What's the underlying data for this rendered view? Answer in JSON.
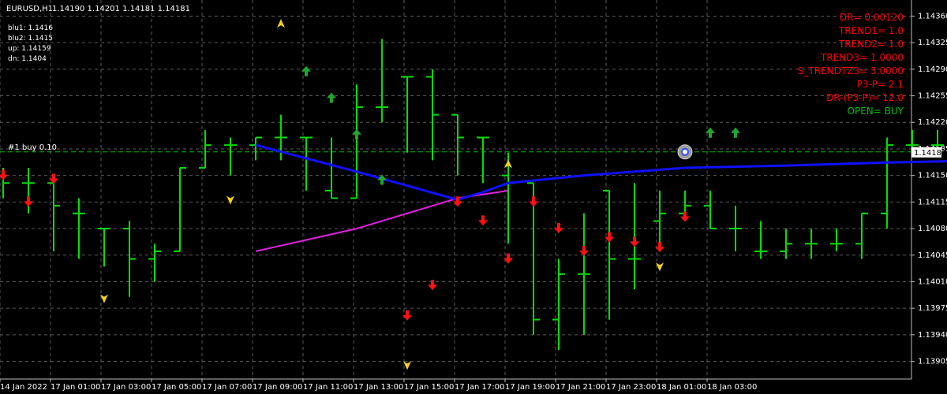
{
  "header": {
    "symbol_timeframe": "EURUSD,H1",
    "ohlc": "1.14190 1.14201 1.14181 1.14181"
  },
  "info_left": [
    {
      "label": "blu1: 1.1416"
    },
    {
      "label": "blu2: 1.1415"
    },
    {
      "label": "up: 1.14159"
    },
    {
      "label": "dn: 1.1404"
    }
  ],
  "info_right": [
    {
      "text": "DR= 0.00120",
      "color": "#ff0000"
    },
    {
      "text": "TREND1= 1.0",
      "color": "#ff0000"
    },
    {
      "text": "TREND2= 1.0",
      "color": "#ff0000"
    },
    {
      "text": "TREND3= 1.0000",
      "color": "#ff0000"
    },
    {
      "text": "S_TRENDTZ3= 3.0000",
      "color": "#ff0000"
    },
    {
      "text": "P3-P= 2.1",
      "color": "#ff0000"
    },
    {
      "text": "DR-(P3-P)= 12.0",
      "color": "#ff0000"
    },
    {
      "text": "OPEN= BUY",
      "color": "#00c000"
    }
  ],
  "order_line": {
    "label": "#1 buy 0.10",
    "price": 1.14181
  },
  "current_price_label": "1.14181",
  "colors": {
    "background": "#000000",
    "grid": "#5a5a5a",
    "bars": "#00e000",
    "blue_line": "#1010ff",
    "magenta_line": "#e020e0",
    "buy_arrow": "#21a531",
    "sell_arrow": "#ff1010",
    "fractal": "#f2d21c",
    "text": "#ffffff"
  },
  "chart_data": {
    "type": "ohlc",
    "price_axis": {
      "min": 1.1389,
      "max": 1.14375,
      "ticks": [
        1.1436,
        1.14325,
        1.1429,
        1.14255,
        1.1422,
        1.14185,
        1.1415,
        1.14115,
        1.1408,
        1.14045,
        1.1401,
        1.13975,
        1.1394,
        1.13905
      ]
    },
    "time_labels": [
      "14 Jan 2022",
      "17 Jan 01:00",
      "17 Jan 03:00",
      "17 Jan 05:00",
      "17 Jan 07:00",
      "17 Jan 09:00",
      "17 Jan 11:00",
      "17 Jan 13:00",
      "17 Jan 15:00",
      "17 Jan 17:00",
      "17 Jan 19:00",
      "17 Jan 21:00",
      "17 Jan 23:00",
      "18 Jan 01:00",
      "18 Jan 03:00"
    ],
    "bars": [
      {
        "o": 1.1415,
        "h": 1.1416,
        "l": 1.1412,
        "c": 1.1414
      },
      {
        "o": 1.1414,
        "h": 1.1416,
        "l": 1.141,
        "c": 1.1414
      },
      {
        "o": 1.1414,
        "h": 1.1414,
        "l": 1.1405,
        "c": 1.1411
      },
      {
        "o": 1.141,
        "h": 1.1412,
        "l": 1.1404,
        "c": 1.141
      },
      {
        "o": 1.1408,
        "h": 1.1408,
        "l": 1.1403,
        "c": 1.1408
      },
      {
        "o": 1.1408,
        "h": 1.1409,
        "l": 1.1399,
        "c": 1.1404
      },
      {
        "o": 1.1404,
        "h": 1.1406,
        "l": 1.1401,
        "c": 1.1405
      },
      {
        "o": 1.1405,
        "h": 1.1416,
        "l": 1.1405,
        "c": 1.1416
      },
      {
        "o": 1.1416,
        "h": 1.1421,
        "l": 1.1416,
        "c": 1.1419
      },
      {
        "o": 1.1419,
        "h": 1.142,
        "l": 1.1415,
        "c": 1.1419
      },
      {
        "o": 1.1419,
        "h": 1.142,
        "l": 1.1417,
        "c": 1.142
      },
      {
        "o": 1.142,
        "h": 1.1423,
        "l": 1.1417,
        "c": 1.142
      },
      {
        "o": 1.142,
        "h": 1.142,
        "l": 1.1413,
        "c": 1.142
      },
      {
        "o": 1.1413,
        "h": 1.142,
        "l": 1.1412,
        "c": 1.1412
      },
      {
        "o": 1.1412,
        "h": 1.1427,
        "l": 1.1412,
        "c": 1.1424
      },
      {
        "o": 1.1424,
        "h": 1.1433,
        "l": 1.1422,
        "c": 1.1424
      },
      {
        "o": 1.1428,
        "h": 1.1428,
        "l": 1.1418,
        "c": 1.1428
      },
      {
        "o": 1.1428,
        "h": 1.1429,
        "l": 1.1417,
        "c": 1.1423
      },
      {
        "o": 1.1423,
        "h": 1.1423,
        "l": 1.1415,
        "c": 1.142
      },
      {
        "o": 1.142,
        "h": 1.142,
        "l": 1.1414,
        "c": 1.142
      },
      {
        "o": 1.1415,
        "h": 1.1418,
        "l": 1.1406,
        "c": 1.1414
      },
      {
        "o": 1.1414,
        "h": 1.1414,
        "l": 1.1394,
        "c": 1.1396
      },
      {
        "o": 1.1396,
        "h": 1.1404,
        "l": 1.1392,
        "c": 1.1402
      },
      {
        "o": 1.1402,
        "h": 1.141,
        "l": 1.1394,
        "c": 1.1402
      },
      {
        "o": 1.1413,
        "h": 1.1413,
        "l": 1.1396,
        "c": 1.1404
      },
      {
        "o": 1.1404,
        "h": 1.1414,
        "l": 1.14,
        "c": 1.1404
      },
      {
        "o": 1.1409,
        "h": 1.1413,
        "l": 1.1406,
        "c": 1.141
      },
      {
        "o": 1.141,
        "h": 1.1413,
        "l": 1.1409,
        "c": 1.1411
      },
      {
        "o": 1.1411,
        "h": 1.1413,
        "l": 1.1408,
        "c": 1.1408
      },
      {
        "o": 1.1408,
        "h": 1.1411,
        "l": 1.1405,
        "c": 1.1408
      },
      {
        "o": 1.1405,
        "h": 1.1409,
        "l": 1.1404,
        "c": 1.1405
      },
      {
        "o": 1.1405,
        "h": 1.1408,
        "l": 1.1404,
        "c": 1.1406
      },
      {
        "o": 1.1406,
        "h": 1.1408,
        "l": 1.1404,
        "c": 1.1406
      },
      {
        "o": 1.1406,
        "h": 1.1408,
        "l": 1.1405,
        "c": 1.1406
      },
      {
        "o": 1.1406,
        "h": 1.141,
        "l": 1.1404,
        "c": 1.141
      },
      {
        "o": 1.141,
        "h": 1.142,
        "l": 1.1408,
        "c": 1.1419
      },
      {
        "o": 1.1419,
        "h": 1.1421,
        "l": 1.1418,
        "c": 1.1419
      },
      {
        "o": 1.1419,
        "h": 1.1421,
        "l": 1.1418,
        "c": 1.1419
      },
      {
        "o": 1.1419,
        "h": 1.1421,
        "l": 1.1418,
        "c": 1.1418
      },
      {
        "o": 1.1418,
        "h": 1.142,
        "l": 1.1418,
        "c": 1.1418
      }
    ],
    "blue_line": [
      {
        "bar": 10,
        "price": 1.1419
      },
      {
        "bar": 14,
        "price": 1.14155
      },
      {
        "bar": 18,
        "price": 1.14118
      },
      {
        "bar": 19,
        "price": 1.14128
      },
      {
        "bar": 20,
        "price": 1.1414
      },
      {
        "bar": 23,
        "price": 1.1415
      },
      {
        "bar": 27,
        "price": 1.1416
      },
      {
        "bar": 31,
        "price": 1.14163
      },
      {
        "bar": 35,
        "price": 1.14167
      },
      {
        "bar": 39,
        "price": 1.1417
      }
    ],
    "magenta_line": [
      {
        "bar": 10,
        "price": 1.1405
      },
      {
        "bar": 14,
        "price": 1.1408
      },
      {
        "bar": 18,
        "price": 1.1412
      },
      {
        "bar": 20,
        "price": 1.1413
      }
    ],
    "buy_arrows": [
      {
        "bar": 12,
        "price": 1.14288
      },
      {
        "bar": 13,
        "price": 1.14253
      },
      {
        "bar": 14,
        "price": 1.14205
      },
      {
        "bar": 15,
        "price": 1.14145
      },
      {
        "bar": 28,
        "price": 1.14207
      },
      {
        "bar": 29,
        "price": 1.14207
      }
    ],
    "sell_arrows": [
      {
        "bar": 0,
        "price": 1.1415
      },
      {
        "bar": 1,
        "price": 1.14115
      },
      {
        "bar": 2,
        "price": 1.14145
      },
      {
        "bar": 17,
        "price": 1.14005
      },
      {
        "bar": 16,
        "price": 1.13965
      },
      {
        "bar": 18,
        "price": 1.14115
      },
      {
        "bar": 19,
        "price": 1.1409
      },
      {
        "bar": 20,
        "price": 1.1404
      },
      {
        "bar": 21,
        "price": 1.14115
      },
      {
        "bar": 22,
        "price": 1.1408
      },
      {
        "bar": 23,
        "price": 1.1405
      },
      {
        "bar": 24,
        "price": 1.14068
      },
      {
        "bar": 25,
        "price": 1.14062
      },
      {
        "bar": 26,
        "price": 1.14055
      },
      {
        "bar": 27,
        "price": 1.14095
      }
    ],
    "fractals_up": [
      {
        "bar": 11,
        "price": 1.1435
      },
      {
        "bar": 20,
        "price": 1.14165
      }
    ],
    "fractals_down": [
      {
        "bar": 9,
        "price": 1.14118
      },
      {
        "bar": 4,
        "price": 1.13988
      },
      {
        "bar": 16,
        "price": 1.139
      },
      {
        "bar": 26,
        "price": 1.1403
      }
    ],
    "position_marker": {
      "bar": 27,
      "price": 1.14181
    }
  }
}
